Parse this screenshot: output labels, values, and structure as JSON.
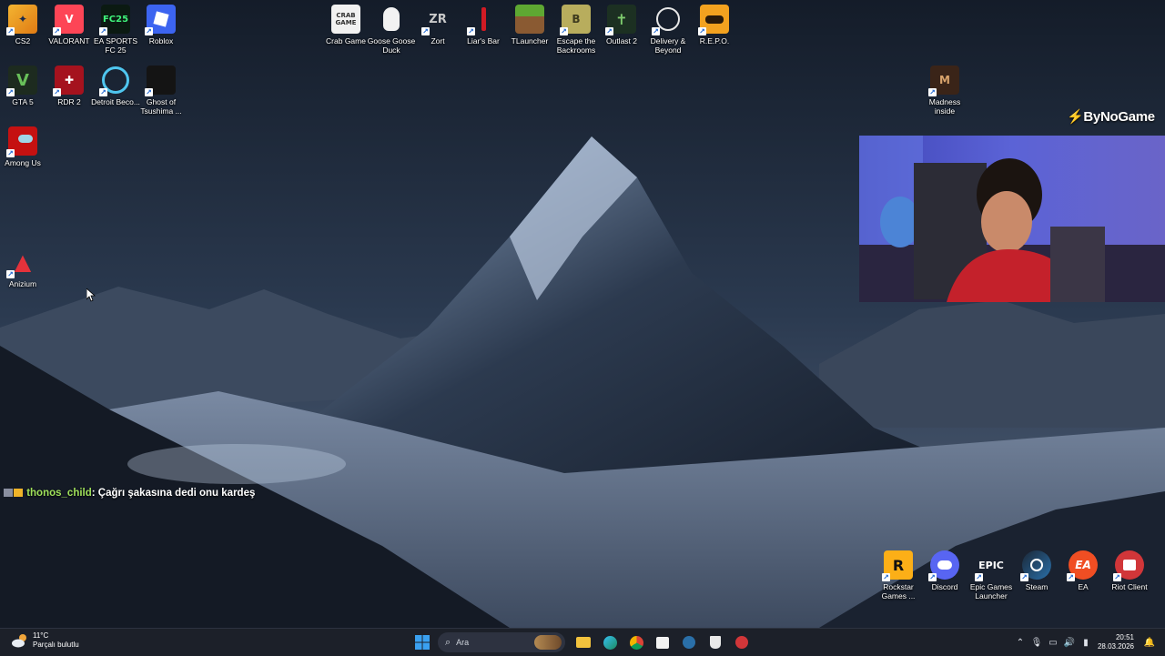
{
  "desktop": {
    "top_left_icons": [
      {
        "label": "CS2"
      },
      {
        "label": "VALORANT"
      },
      {
        "label": "EA SPORTS FC 25"
      },
      {
        "label": "Roblox"
      },
      {
        "label": "GTA 5"
      },
      {
        "label": "RDR 2"
      },
      {
        "label": "Detroit Beco..."
      },
      {
        "label": "Ghost of Tsushima ..."
      },
      {
        "label": "Among Us"
      },
      {
        "label": "Anizium"
      }
    ],
    "top_center_icons": [
      {
        "label": "Crab Game"
      },
      {
        "label": "Goose Goose Duck"
      },
      {
        "label": "Zort"
      },
      {
        "label": "Liar's Bar"
      },
      {
        "label": "TLauncher"
      },
      {
        "label": "Escape the Backrooms"
      },
      {
        "label": "Outlast 2"
      },
      {
        "label": "Delivery & Beyond"
      },
      {
        "label": "R.E.P.O."
      }
    ],
    "right_icons": [
      {
        "label": "Madness inside"
      }
    ],
    "bottom_right_icons": [
      {
        "label": "Rockstar Games ..."
      },
      {
        "label": "Discord"
      },
      {
        "label": "Epic Games Launcher"
      },
      {
        "label": "Steam"
      },
      {
        "label": "EA"
      },
      {
        "label": "Riot Client"
      }
    ],
    "icon_text": {
      "crab": "CRAB GAME",
      "fc25": "FC25",
      "epic": "EPIC",
      "ea": "EA",
      "rockstar": "R",
      "gta": "V",
      "zort": "ZR",
      "madness": "M"
    }
  },
  "overlay": {
    "brand": "ByNoGame",
    "chat": {
      "username": "thonos_child",
      "message": ": Çağrı şakasına dedi onu kardeş"
    }
  },
  "taskbar": {
    "weather_temp": "11°C",
    "weather_desc": "Parçalı bulutlu",
    "search_placeholder": "Ara",
    "time": "20:51",
    "date": "28.03.2026"
  }
}
